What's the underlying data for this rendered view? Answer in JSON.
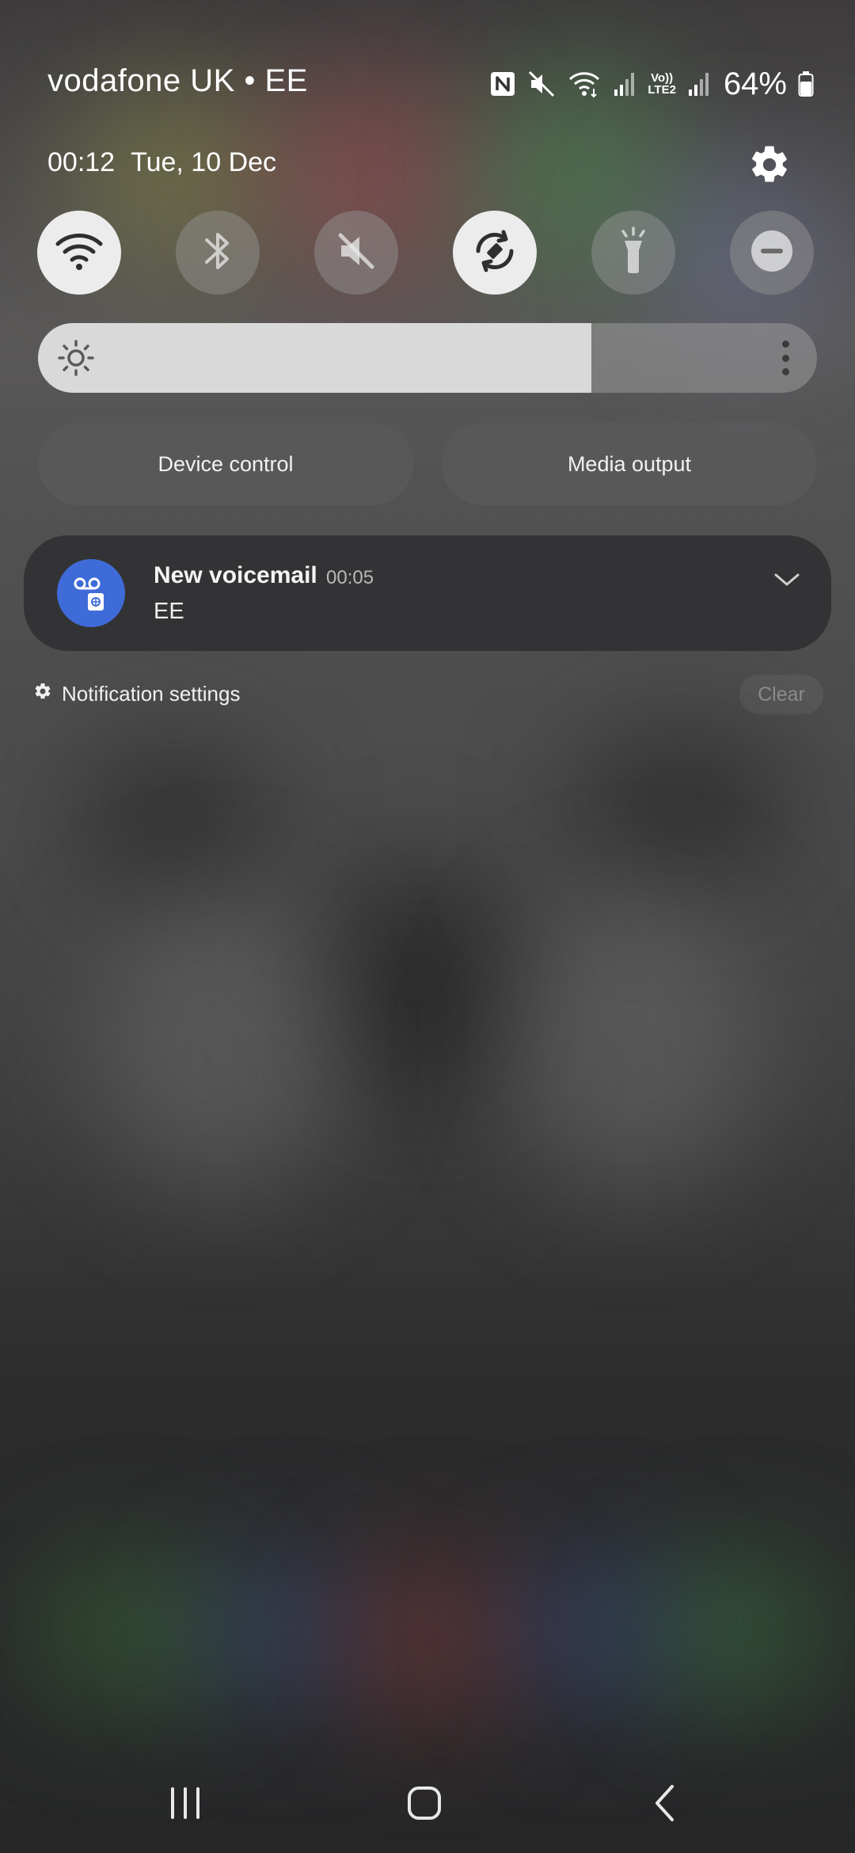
{
  "status_bar": {
    "carrier": "vodafone UK • EE",
    "network_badge_top": "Vo))",
    "network_badge_bottom": "LTE2",
    "battery_percent": "64%",
    "icons": [
      "nfc-icon",
      "mute-icon",
      "wifi-icon",
      "signal-icon",
      "volte-icon",
      "signal-icon",
      "battery-icon"
    ]
  },
  "header": {
    "time": "00:12",
    "date": "Tue, 10 Dec"
  },
  "quick_settings": {
    "tiles": [
      {
        "name": "wifi",
        "icon": "wifi-icon",
        "on": true
      },
      {
        "name": "bluetooth",
        "icon": "bluetooth-icon",
        "on": false
      },
      {
        "name": "sound",
        "icon": "mute-icon",
        "on": false
      },
      {
        "name": "auto-rotate",
        "icon": "rotate-icon",
        "on": true
      },
      {
        "name": "flashlight",
        "icon": "flashlight-icon",
        "on": false
      },
      {
        "name": "do-not-disturb",
        "icon": "dnd-icon",
        "on": false
      }
    ],
    "brightness_level": 0.71
  },
  "pills": {
    "device_control": "Device control",
    "media_output": "Media output"
  },
  "notification": {
    "app_icon": "voicemail-icon",
    "title": "New voicemail",
    "time": "00:05",
    "text": "EE"
  },
  "footer": {
    "notification_settings": "Notification settings",
    "clear": "Clear"
  },
  "nav": {
    "buttons": [
      "recents-icon",
      "home-icon",
      "back-icon"
    ]
  }
}
